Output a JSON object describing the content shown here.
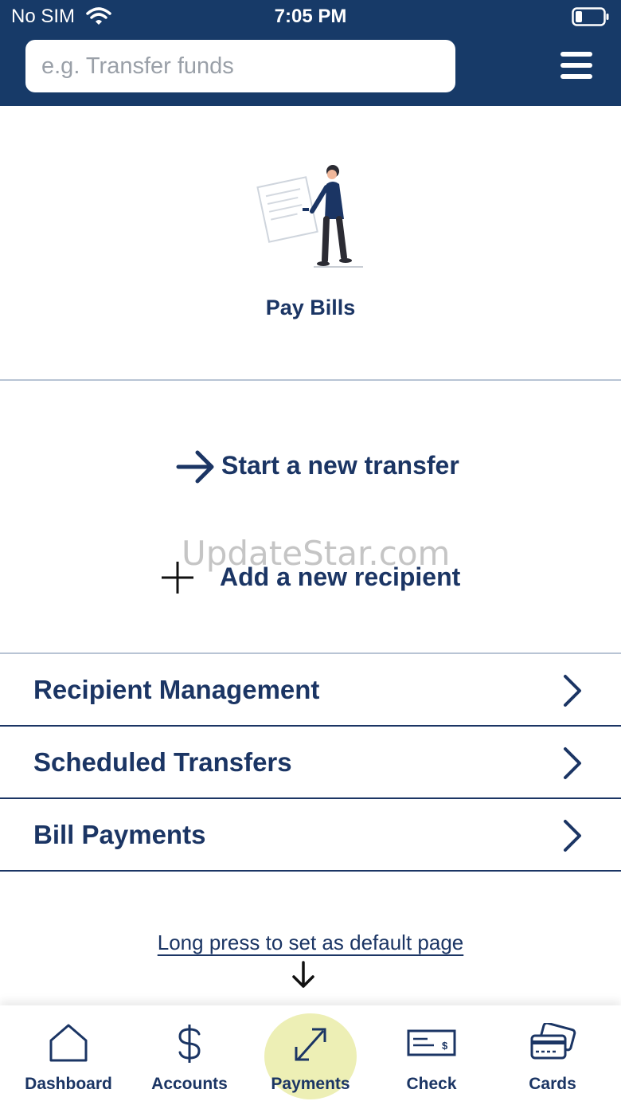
{
  "status_bar": {
    "carrier": "No SIM",
    "time": "7:05 PM"
  },
  "search": {
    "placeholder": "e.g. Transfer funds"
  },
  "hero": {
    "title": "Pay Bills"
  },
  "actions": {
    "start_transfer": "Start a new transfer",
    "add_recipient": "Add a new recipient"
  },
  "watermark": "UpdateStar.com",
  "list": [
    {
      "label": "Recipient Management"
    },
    {
      "label": "Scheduled Transfers"
    },
    {
      "label": "Bill Payments"
    }
  ],
  "hint": "Long press to set as default page",
  "tabs": [
    {
      "label": "Dashboard",
      "icon": "home-icon"
    },
    {
      "label": "Accounts",
      "icon": "dollar-icon"
    },
    {
      "label": "Payments",
      "icon": "transfer-arrows-icon",
      "active": true
    },
    {
      "label": "Check",
      "icon": "check-icon"
    },
    {
      "label": "Cards",
      "icon": "cards-icon"
    }
  ],
  "colors": {
    "header": "#173a68",
    "primary_text": "#1b3564",
    "active_highlight": "#e6e896"
  }
}
